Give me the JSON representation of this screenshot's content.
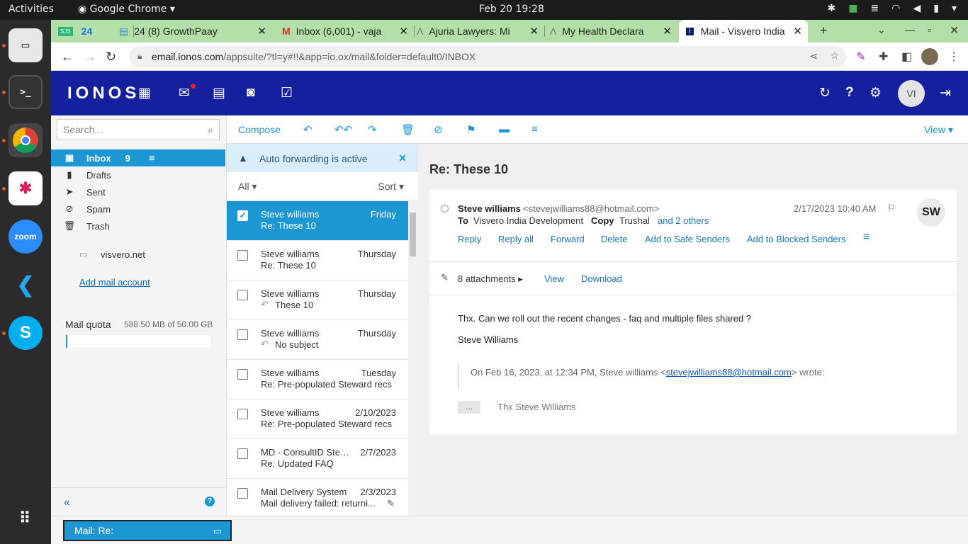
{
  "system": {
    "activities": "Activities",
    "app": "Google Chrome",
    "clock": "Feb 20  19:28"
  },
  "dock": {
    "zoom": "zoom"
  },
  "tabs": [
    {
      "label": "24"
    },
    {
      "label": "24  (8) GrowthPaay"
    },
    {
      "label": "Inbox (6,001) - vaja"
    },
    {
      "label": "Ajuria Lawyers: Mi"
    },
    {
      "label": "My Health Declara"
    },
    {
      "label": "Mail - Visvero India"
    }
  ],
  "url": {
    "host": "email.ionos.com",
    "path": "/appsuite/?tl=y#!!&app=io.ox/mail&folder=default0/INBOX"
  },
  "header": {
    "logo": "IONOS",
    "avatar": "VI"
  },
  "search": {
    "placeholder": "Search..."
  },
  "folders": [
    {
      "label": "Inbox",
      "count": "9"
    },
    {
      "label": "Drafts"
    },
    {
      "label": "Sent"
    },
    {
      "label": "Spam"
    },
    {
      "label": "Trash"
    },
    {
      "label": "visvero.net"
    }
  ],
  "add_mail": "Add mail account",
  "quota": {
    "label": "Mail quota",
    "value": "588.50 MB of 50.00 GB",
    "fraction": 0.012
  },
  "toolbar": {
    "compose": "Compose",
    "view": "View"
  },
  "notice": "Auto forwarding is active",
  "list_header": {
    "all": "All",
    "sort": "Sort"
  },
  "messages": [
    {
      "from": "Steve williams",
      "date": "Friday",
      "subject": "Re: These 10"
    },
    {
      "from": "Steve williams",
      "date": "Thursday",
      "subject": "Re: These 10"
    },
    {
      "from": "Steve williams",
      "date": "Thursday",
      "subject": "These 10"
    },
    {
      "from": "Steve williams",
      "date": "Thursday",
      "subject": "No subject"
    },
    {
      "from": "Steve williams",
      "date": "Tuesday",
      "subject": "Re: Pre-populated Steward recs"
    },
    {
      "from": "Steve williams",
      "date": "2/10/2023",
      "subject": "Re: Pre-populated Steward recs"
    },
    {
      "from": "MD - ConsultID Step...",
      "date": "2/7/2023",
      "subject": "Re: Updated FAQ"
    },
    {
      "from": "Mail Delivery System",
      "date": "2/3/2023",
      "subject": "Mail delivery failed: returni..."
    }
  ],
  "mail": {
    "title": "Re: These 10",
    "from_name": "Steve williams",
    "from_email": "<stevejwilliams88@hotmail.com>",
    "datetime": "2/17/2023 10:40 AM",
    "to_label": "To",
    "to": "Visvero India Development",
    "copy_label": "Copy",
    "copy": "Trushal",
    "others": "and 2 others",
    "actions": [
      "Reply",
      "Reply all",
      "Forward",
      "Delete",
      "Add to Safe Senders",
      "Add to Blocked Senders"
    ],
    "initials": "SW",
    "attachments": "8 attachments",
    "view": "View",
    "download": "Download",
    "body": "Thx.  Can we roll out the recent changes - faq and multiple files shared ?",
    "signature": "Steve Williams",
    "quote_pre": "On Feb 16, 2023, at 12:34 PM, Steve williams <",
    "quote_link": "stevejwilliams88@hotmail.com",
    "quote_post": "> wrote:",
    "dots": "...",
    "quoted_text": "Thx Steve Williams"
  },
  "taskbar": {
    "label": "Mail: Re:"
  }
}
